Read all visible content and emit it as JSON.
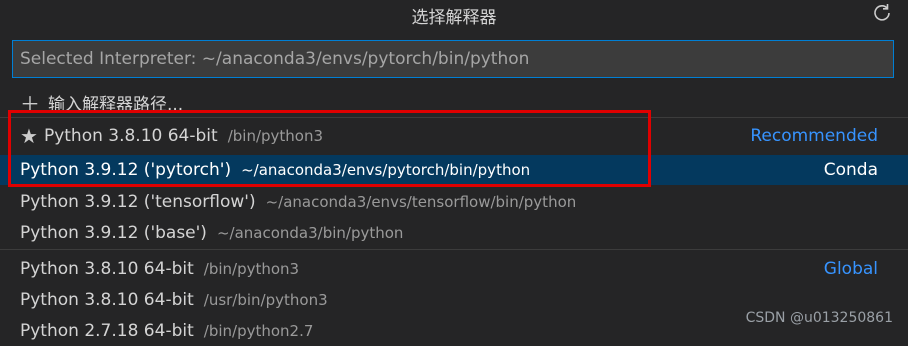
{
  "header": {
    "title": "选择解释器",
    "refresh_icon": "refresh-icon"
  },
  "search": {
    "placeholder": "Selected Interpreter: ~/anaconda3/envs/pytorch/bin/python"
  },
  "enter_path": {
    "icon": "plus-icon",
    "label": "输入解释器路径..."
  },
  "interpreters": [
    {
      "label": "Python 3.8.10 64-bit",
      "path": "/bin/python3",
      "tag": "Recommended",
      "icon": "star-icon"
    },
    {
      "label": "Python 3.9.12 ('pytorch')",
      "path": "~/anaconda3/envs/pytorch/bin/python",
      "tag": "Conda",
      "selected": true
    },
    {
      "label": "Python 3.9.12 ('tensorflow')",
      "path": "~/anaconda3/envs/tensorflow/bin/python",
      "tag": ""
    },
    {
      "label": "Python 3.9.12 ('base')",
      "path": "~/anaconda3/bin/python",
      "tag": ""
    },
    {
      "label": "Python 3.8.10 64-bit",
      "path": "/bin/python3",
      "tag": "Global"
    },
    {
      "label": "Python 3.8.10 64-bit",
      "path": "/usr/bin/python3",
      "tag": ""
    },
    {
      "label": "Python 2.7.18 64-bit",
      "path": "/bin/python2.7",
      "tag": ""
    }
  ],
  "watermark": "CSDN @u013250861",
  "colors": {
    "background": "#252526",
    "selected_row": "#04395e",
    "accent": "#3794ff",
    "highlight_box": "#e00000"
  }
}
